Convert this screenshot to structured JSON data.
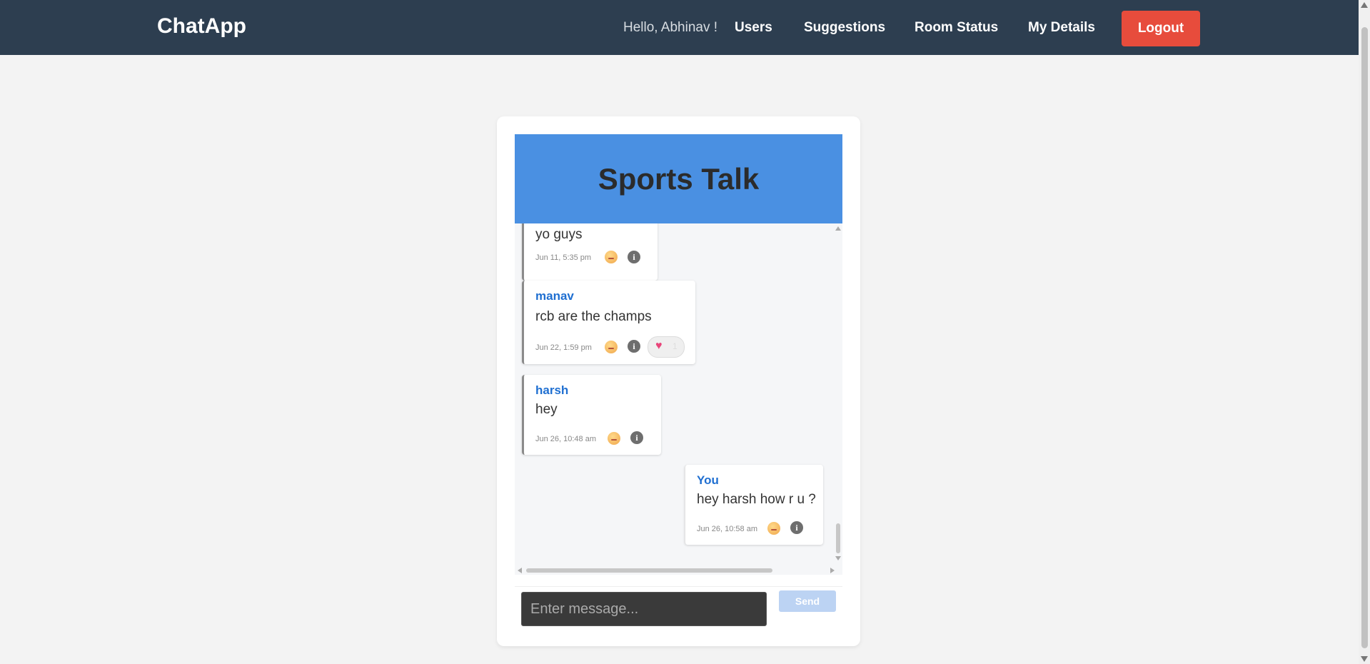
{
  "navbar": {
    "brand": "ChatApp",
    "greeting": "Hello, Abhinav !",
    "links": [
      "Users",
      "Suggestions",
      "Room Status",
      "My Details"
    ],
    "logout": "Logout"
  },
  "room": {
    "title": "Sports Talk"
  },
  "messages": [
    {
      "sender": "",
      "text": "yo guys",
      "time": "Jun 11, 5:35 pm"
    },
    {
      "sender": "manav",
      "text": "rcb are the champs",
      "time": "Jun 22, 1:59 pm",
      "reaction": {
        "icon": "heart-icon",
        "count": "1"
      }
    },
    {
      "sender": "harsh",
      "text": "hey",
      "time": "Jun 26, 10:48 am"
    },
    {
      "sender": "You",
      "text": "hey harsh how r u ?",
      "time": "Jun 26, 10:58 am"
    }
  ],
  "composer": {
    "placeholder": "Enter message...",
    "send": "Send"
  },
  "colors": {
    "navbar": "#2d3e50",
    "logout": "#e74c3c",
    "room_header": "#4a90e2",
    "sender": "#1f6fd1"
  }
}
